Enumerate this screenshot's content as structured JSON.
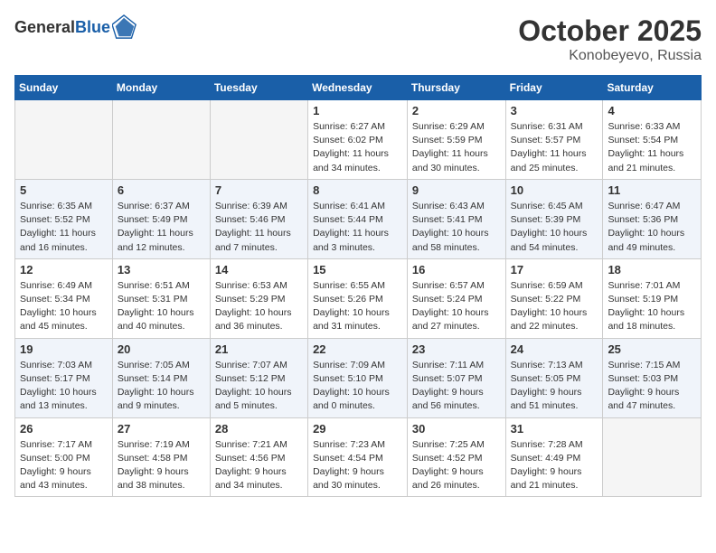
{
  "header": {
    "logo_general": "General",
    "logo_blue": "Blue",
    "month": "October 2025",
    "location": "Konobeyevo, Russia"
  },
  "days_of_week": [
    "Sunday",
    "Monday",
    "Tuesday",
    "Wednesday",
    "Thursday",
    "Friday",
    "Saturday"
  ],
  "weeks": [
    {
      "days": [
        {
          "num": "",
          "info": ""
        },
        {
          "num": "",
          "info": ""
        },
        {
          "num": "",
          "info": ""
        },
        {
          "num": "1",
          "info": "Sunrise: 6:27 AM\nSunset: 6:02 PM\nDaylight: 11 hours\nand 34 minutes."
        },
        {
          "num": "2",
          "info": "Sunrise: 6:29 AM\nSunset: 5:59 PM\nDaylight: 11 hours\nand 30 minutes."
        },
        {
          "num": "3",
          "info": "Sunrise: 6:31 AM\nSunset: 5:57 PM\nDaylight: 11 hours\nand 25 minutes."
        },
        {
          "num": "4",
          "info": "Sunrise: 6:33 AM\nSunset: 5:54 PM\nDaylight: 11 hours\nand 21 minutes."
        }
      ]
    },
    {
      "days": [
        {
          "num": "5",
          "info": "Sunrise: 6:35 AM\nSunset: 5:52 PM\nDaylight: 11 hours\nand 16 minutes."
        },
        {
          "num": "6",
          "info": "Sunrise: 6:37 AM\nSunset: 5:49 PM\nDaylight: 11 hours\nand 12 minutes."
        },
        {
          "num": "7",
          "info": "Sunrise: 6:39 AM\nSunset: 5:46 PM\nDaylight: 11 hours\nand 7 minutes."
        },
        {
          "num": "8",
          "info": "Sunrise: 6:41 AM\nSunset: 5:44 PM\nDaylight: 11 hours\nand 3 minutes."
        },
        {
          "num": "9",
          "info": "Sunrise: 6:43 AM\nSunset: 5:41 PM\nDaylight: 10 hours\nand 58 minutes."
        },
        {
          "num": "10",
          "info": "Sunrise: 6:45 AM\nSunset: 5:39 PM\nDaylight: 10 hours\nand 54 minutes."
        },
        {
          "num": "11",
          "info": "Sunrise: 6:47 AM\nSunset: 5:36 PM\nDaylight: 10 hours\nand 49 minutes."
        }
      ]
    },
    {
      "days": [
        {
          "num": "12",
          "info": "Sunrise: 6:49 AM\nSunset: 5:34 PM\nDaylight: 10 hours\nand 45 minutes."
        },
        {
          "num": "13",
          "info": "Sunrise: 6:51 AM\nSunset: 5:31 PM\nDaylight: 10 hours\nand 40 minutes."
        },
        {
          "num": "14",
          "info": "Sunrise: 6:53 AM\nSunset: 5:29 PM\nDaylight: 10 hours\nand 36 minutes."
        },
        {
          "num": "15",
          "info": "Sunrise: 6:55 AM\nSunset: 5:26 PM\nDaylight: 10 hours\nand 31 minutes."
        },
        {
          "num": "16",
          "info": "Sunrise: 6:57 AM\nSunset: 5:24 PM\nDaylight: 10 hours\nand 27 minutes."
        },
        {
          "num": "17",
          "info": "Sunrise: 6:59 AM\nSunset: 5:22 PM\nDaylight: 10 hours\nand 22 minutes."
        },
        {
          "num": "18",
          "info": "Sunrise: 7:01 AM\nSunset: 5:19 PM\nDaylight: 10 hours\nand 18 minutes."
        }
      ]
    },
    {
      "days": [
        {
          "num": "19",
          "info": "Sunrise: 7:03 AM\nSunset: 5:17 PM\nDaylight: 10 hours\nand 13 minutes."
        },
        {
          "num": "20",
          "info": "Sunrise: 7:05 AM\nSunset: 5:14 PM\nDaylight: 10 hours\nand 9 minutes."
        },
        {
          "num": "21",
          "info": "Sunrise: 7:07 AM\nSunset: 5:12 PM\nDaylight: 10 hours\nand 5 minutes."
        },
        {
          "num": "22",
          "info": "Sunrise: 7:09 AM\nSunset: 5:10 PM\nDaylight: 10 hours\nand 0 minutes."
        },
        {
          "num": "23",
          "info": "Sunrise: 7:11 AM\nSunset: 5:07 PM\nDaylight: 9 hours\nand 56 minutes."
        },
        {
          "num": "24",
          "info": "Sunrise: 7:13 AM\nSunset: 5:05 PM\nDaylight: 9 hours\nand 51 minutes."
        },
        {
          "num": "25",
          "info": "Sunrise: 7:15 AM\nSunset: 5:03 PM\nDaylight: 9 hours\nand 47 minutes."
        }
      ]
    },
    {
      "days": [
        {
          "num": "26",
          "info": "Sunrise: 7:17 AM\nSunset: 5:00 PM\nDaylight: 9 hours\nand 43 minutes."
        },
        {
          "num": "27",
          "info": "Sunrise: 7:19 AM\nSunset: 4:58 PM\nDaylight: 9 hours\nand 38 minutes."
        },
        {
          "num": "28",
          "info": "Sunrise: 7:21 AM\nSunset: 4:56 PM\nDaylight: 9 hours\nand 34 minutes."
        },
        {
          "num": "29",
          "info": "Sunrise: 7:23 AM\nSunset: 4:54 PM\nDaylight: 9 hours\nand 30 minutes."
        },
        {
          "num": "30",
          "info": "Sunrise: 7:25 AM\nSunset: 4:52 PM\nDaylight: 9 hours\nand 26 minutes."
        },
        {
          "num": "31",
          "info": "Sunrise: 7:28 AM\nSunset: 4:49 PM\nDaylight: 9 hours\nand 21 minutes."
        },
        {
          "num": "",
          "info": ""
        }
      ]
    }
  ]
}
